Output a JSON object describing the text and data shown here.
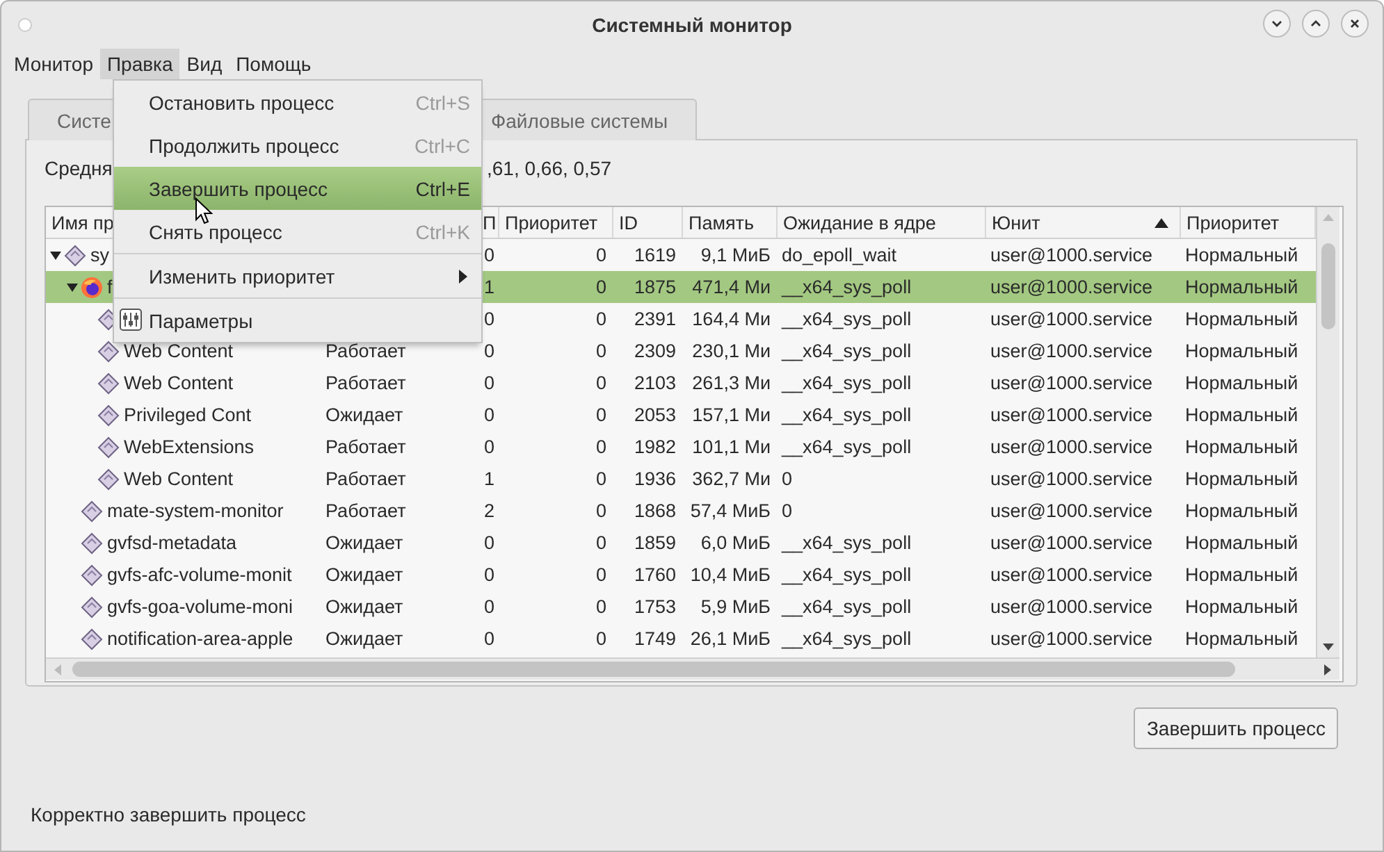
{
  "window": {
    "title": "Системный монитор"
  },
  "menubar": [
    {
      "label": "Монитор",
      "selected": false
    },
    {
      "label": "Правка",
      "selected": true
    },
    {
      "label": "Вид",
      "selected": false
    },
    {
      "label": "Помощь",
      "selected": false
    }
  ],
  "menu": [
    {
      "kind": "action",
      "label": "Остановить процесс",
      "shortcut": "Ctrl+S",
      "selected": false
    },
    {
      "kind": "action",
      "label": "Продолжить процесс",
      "shortcut": "Ctrl+C",
      "selected": false
    },
    {
      "kind": "action",
      "label": "Завершить процесс",
      "shortcut": "Ctrl+E",
      "selected": true
    },
    {
      "kind": "action",
      "label": "Снять процесс",
      "shortcut": "Ctrl+K",
      "selected": false
    },
    {
      "kind": "separator"
    },
    {
      "kind": "submenu",
      "label": "Изменить приоритет",
      "selected": false
    },
    {
      "kind": "separator"
    },
    {
      "kind": "icon",
      "label": "Параметры",
      "selected": false
    }
  ],
  "tabs": [
    {
      "label": "Систе",
      "selected": false
    },
    {
      "label": "Файловые системы",
      "selected": false
    }
  ],
  "load": {
    "label": "Средня",
    "values": ",61, 0,66, 0,57"
  },
  "table": {
    "columns": [
      {
        "label": "Имя пр"
      },
      {},
      {
        "label": "П"
      },
      {
        "label": "Приоритет"
      },
      {
        "label": "ID"
      },
      {
        "label": "Память"
      },
      {
        "label": "Ожидание в ядре"
      },
      {
        "label": "Юнит",
        "sorted": true
      },
      {
        "label": "Приоритет"
      }
    ],
    "rows": [
      {
        "kind": "process",
        "name": "sy",
        "cpu": "0",
        "nice": "0",
        "id": "1619",
        "memory": "9,1 МиБ",
        "wait": "do_epoll_wait",
        "unit": "user@1000.service",
        "priority": "Нормальный",
        "selected": false,
        "expanded": true,
        "children": [
          {
            "kind": "firefox",
            "name": "f",
            "cpu": "1",
            "nice": "0",
            "id": "1875",
            "memory": "471,4 Ми",
            "wait": "__x64_sys_poll",
            "unit": "user@1000.service",
            "priority": "Нормальный",
            "selected": true,
            "expanded": true,
            "children": [
              {
                "kind": "process",
                "cpu": "0",
                "nice": "0",
                "id": "2391",
                "memory": "164,4 Ми",
                "wait": "__x64_sys_poll",
                "unit": "user@1000.service",
                "priority": "Нормальный",
                "selected": false
              },
              {
                "kind": "process",
                "name": "Web Content",
                "status": "Работает",
                "cpu": "0",
                "nice": "0",
                "id": "2309",
                "memory": "230,1 Ми",
                "wait": "__x64_sys_poll",
                "unit": "user@1000.service",
                "priority": "Нормальный",
                "selected": false
              },
              {
                "kind": "process",
                "name": "Web Content",
                "status": "Работает",
                "cpu": "0",
                "nice": "0",
                "id": "2103",
                "memory": "261,3 Ми",
                "wait": "__x64_sys_poll",
                "unit": "user@1000.service",
                "priority": "Нормальный",
                "selected": false
              },
              {
                "kind": "process",
                "name": "Privileged Cont",
                "status": "Ожидает",
                "cpu": "0",
                "nice": "0",
                "id": "2053",
                "memory": "157,1 Ми",
                "wait": "__x64_sys_poll",
                "unit": "user@1000.service",
                "priority": "Нормальный",
                "selected": false
              },
              {
                "kind": "process",
                "name": "WebExtensions",
                "status": "Работает",
                "cpu": "0",
                "nice": "0",
                "id": "1982",
                "memory": "101,1 Ми",
                "wait": "__x64_sys_poll",
                "unit": "user@1000.service",
                "priority": "Нормальный",
                "selected": false
              },
              {
                "kind": "process",
                "name": "Web Content",
                "status": "Работает",
                "cpu": "1",
                "nice": "0",
                "id": "1936",
                "memory": "362,7 Ми",
                "wait": "0",
                "unit": "user@1000.service",
                "priority": "Нормальный",
                "selected": false
              }
            ]
          },
          {
            "kind": "process",
            "name": "mate-system-monitor",
            "status": "Работает",
            "cpu": "2",
            "nice": "0",
            "id": "1868",
            "memory": "57,4 МиБ",
            "wait": "0",
            "unit": "user@1000.service",
            "priority": "Нормальный",
            "selected": false
          },
          {
            "kind": "process",
            "name": "gvfsd-metadata",
            "status": "Ожидает",
            "cpu": "0",
            "nice": "0",
            "id": "1859",
            "memory": "6,0 МиБ",
            "wait": "__x64_sys_poll",
            "unit": "user@1000.service",
            "priority": "Нормальный",
            "selected": false
          },
          {
            "kind": "process",
            "name": "gvfs-afc-volume-monit",
            "status": "Ожидает",
            "cpu": "0",
            "nice": "0",
            "id": "1760",
            "memory": "10,4 МиБ",
            "wait": "__x64_sys_poll",
            "unit": "user@1000.service",
            "priority": "Нормальный",
            "selected": false
          },
          {
            "kind": "process",
            "name": "gvfs-goa-volume-moni",
            "status": "Ожидает",
            "cpu": "0",
            "nice": "0",
            "id": "1753",
            "memory": "5,9 МиБ",
            "wait": "__x64_sys_poll",
            "unit": "user@1000.service",
            "priority": "Нормальный",
            "selected": false
          },
          {
            "kind": "process",
            "name": "notification-area-apple",
            "status": "Ожидает",
            "cpu": "0",
            "nice": "0",
            "id": "1749",
            "memory": "26,1 МиБ",
            "wait": "__x64_sys_poll",
            "unit": "user@1000.service",
            "priority": "Нормальный",
            "selected": false
          }
        ]
      }
    ]
  },
  "end_button": "Завершить процесс",
  "status_bar": "Корректно завершить процесс"
}
